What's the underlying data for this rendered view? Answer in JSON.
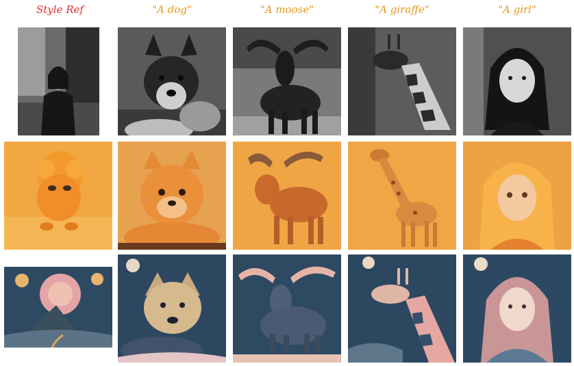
{
  "headers": {
    "style_ref": "Style Ref",
    "prompts": [
      "\"A dog\"",
      "\"A moose\"",
      "\"A giraffe\"",
      "\"A girl\""
    ]
  },
  "rows": [
    {
      "style": "black-and-white photograph",
      "subjects": [
        "woman-photo",
        "dog",
        "moose",
        "giraffe",
        "girl"
      ]
    },
    {
      "style": "orange 3d render",
      "subjects": [
        "orange-creature",
        "dog",
        "moose",
        "giraffe",
        "girl"
      ]
    },
    {
      "style": "starry night illustration",
      "subjects": [
        "starry-landscape",
        "dog",
        "moose",
        "giraffe",
        "girl"
      ]
    }
  ],
  "colors": {
    "style_ref_label": "#e02a2a",
    "prompt_label": "#e8961a",
    "orange_bg": "#f1a742",
    "night_bg": "#2d4760"
  }
}
